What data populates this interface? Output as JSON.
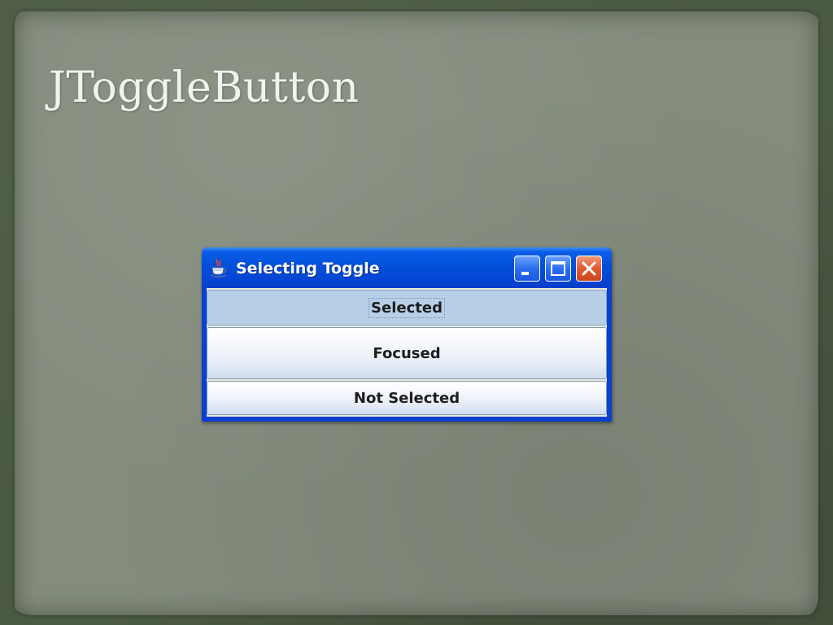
{
  "slide": {
    "title": "JToggleButton"
  },
  "window": {
    "title": "Selecting Toggle",
    "icon": "java-cup-icon",
    "controls": [
      "minimize-icon",
      "maximize-icon",
      "close-icon"
    ]
  },
  "toggles": [
    {
      "label": "Selected",
      "state": "selected"
    },
    {
      "label": "Focused",
      "state": "focused"
    },
    {
      "label": "Not Selected",
      "state": "not-selected"
    }
  ],
  "colors": {
    "titlebar": "#0350d8",
    "selected_fill": "#b8cfe8",
    "close_button": "#e15a2d",
    "slide_background": "#838c7d",
    "slide_title_text": "#f2f2ee"
  }
}
